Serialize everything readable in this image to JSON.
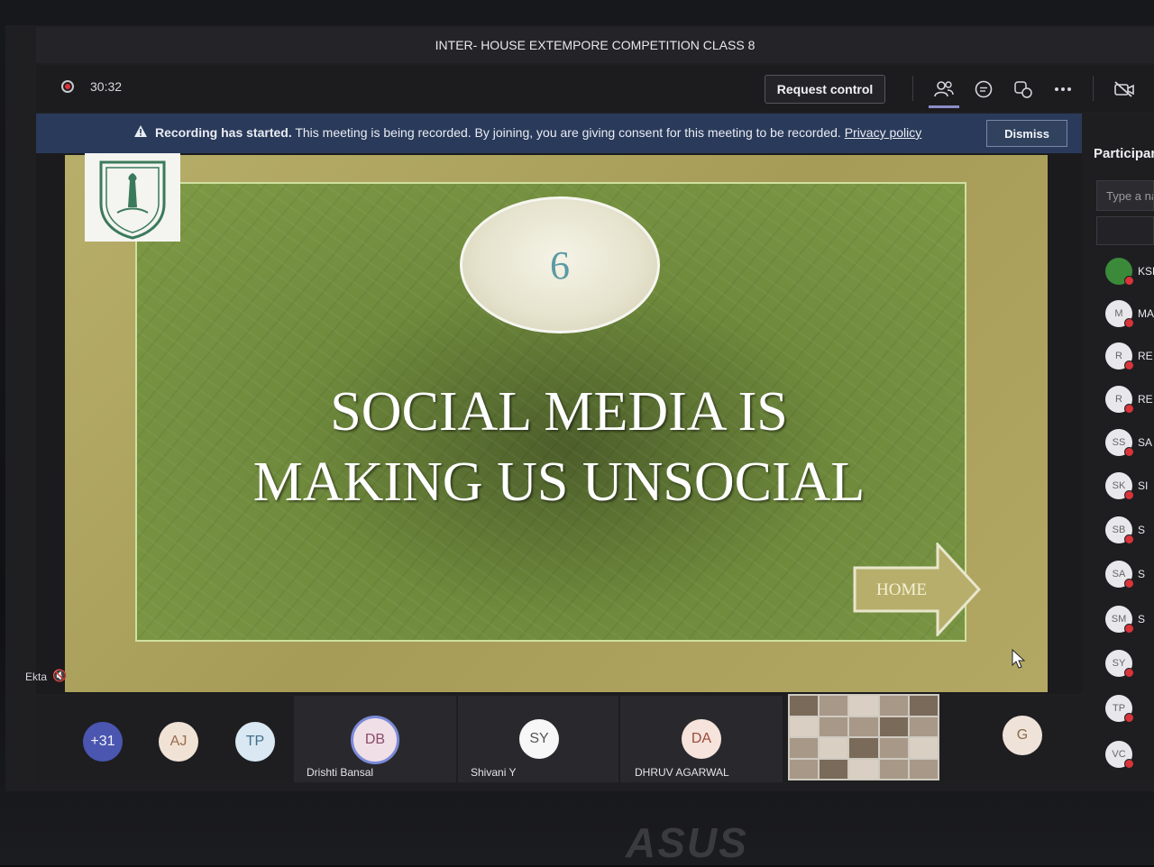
{
  "meeting": {
    "title": "INTER- HOUSE EXTEMPORE COMPETITION CLASS 8",
    "timer": "30:32",
    "request_control_label": "Request control"
  },
  "banner": {
    "bold_text": "Recording has started.",
    "text": " This meeting is being recorded. By joining, you are giving consent for this meeting to be recorded. ",
    "link": "Privacy policy",
    "dismiss_label": "Dismiss"
  },
  "slide": {
    "number": "6",
    "title_line1": "SOCIAL MEDIA IS",
    "title_line2": "MAKING US UNSOCIAL",
    "home_label": "HOME"
  },
  "presenter_label": "Ekta",
  "tiles": [
    {
      "initials": "+31",
      "name": ""
    },
    {
      "initials": "AJ",
      "name": ""
    },
    {
      "initials": "TP",
      "name": ""
    },
    {
      "initials": "DB",
      "name": "Drishti Bansal"
    },
    {
      "initials": "SY",
      "name": "Shivani Y"
    },
    {
      "initials": "DA",
      "name": "DHRUV AGARWAL"
    },
    {
      "initials": "G",
      "name": ""
    }
  ],
  "participants_panel": {
    "title": "Participants",
    "search_placeholder": "Type a name",
    "items": [
      {
        "initials": "",
        "name": "KSH"
      },
      {
        "initials": "M",
        "name": "MA"
      },
      {
        "initials": "R",
        "name": "RE"
      },
      {
        "initials": "R",
        "name": "RE"
      },
      {
        "initials": "SS",
        "name": "SA"
      },
      {
        "initials": "SK",
        "name": "SI"
      },
      {
        "initials": "SB",
        "name": "S"
      },
      {
        "initials": "SA",
        "name": "S"
      },
      {
        "initials": "SM",
        "name": "S"
      },
      {
        "initials": "SY",
        "name": ""
      },
      {
        "initials": "TP",
        "name": ""
      },
      {
        "initials": "VC",
        "name": ""
      }
    ]
  },
  "device_brand": "ASUS"
}
